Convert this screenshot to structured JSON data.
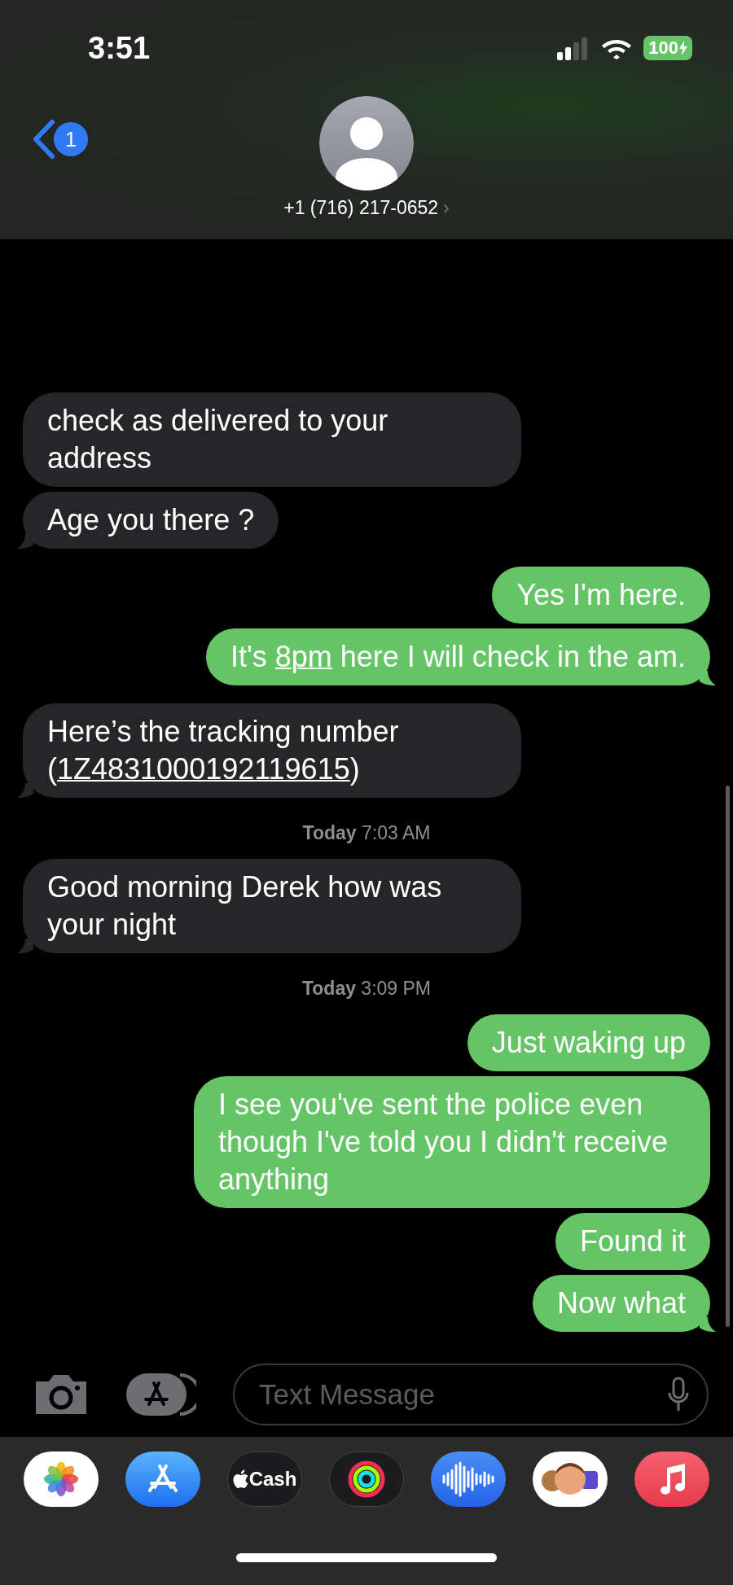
{
  "status_bar": {
    "time": "3:51",
    "battery": "100"
  },
  "header": {
    "back_badge": "1",
    "contact": "+1 (716) 217-0652",
    "chevron": "›"
  },
  "messages": [
    {
      "kind": "message",
      "outgoing": false,
      "parts": [
        {
          "text": "check as delivered to your address"
        }
      ]
    },
    {
      "kind": "message",
      "outgoing": false,
      "parts": [
        {
          "text": "Age you there ?"
        }
      ]
    },
    {
      "kind": "message",
      "outgoing": true,
      "parts": [
        {
          "text": "Yes I'm here."
        }
      ]
    },
    {
      "kind": "message",
      "outgoing": true,
      "parts": [
        {
          "text": "It's "
        },
        {
          "text": "8pm",
          "link": true
        },
        {
          "text": " here I will check in the am."
        }
      ]
    },
    {
      "kind": "message",
      "outgoing": false,
      "parts": [
        {
          "text": "Here’s the tracking number ("
        },
        {
          "text": "1Z4831000192119615",
          "link": true
        },
        {
          "text": ")"
        }
      ]
    },
    {
      "kind": "timestamp",
      "text": "**Today** 7:03 AM"
    },
    {
      "kind": "message",
      "outgoing": false,
      "parts": [
        {
          "text": "Good morning Derek how was your night"
        }
      ]
    },
    {
      "kind": "timestamp",
      "text": "**Today** 3:09 PM"
    },
    {
      "kind": "message",
      "outgoing": true,
      "parts": [
        {
          "text": "Just waking up"
        }
      ]
    },
    {
      "kind": "message",
      "outgoing": true,
      "parts": [
        {
          "text": "I see you've sent the police even though I've told you I didn't receive anything"
        }
      ]
    },
    {
      "kind": "message",
      "outgoing": true,
      "parts": [
        {
          "text": "Found it"
        }
      ]
    },
    {
      "kind": "message",
      "outgoing": true,
      "parts": [
        {
          "text": "Now what"
        }
      ]
    }
  ],
  "composer": {
    "placeholder": "Text Message"
  },
  "app_drawer": [
    {
      "kind": "photos"
    },
    {
      "kind": "appstore"
    },
    {
      "kind": "cash",
      "label": "Cash"
    },
    {
      "kind": "activity"
    },
    {
      "kind": "audio"
    },
    {
      "kind": "memoji"
    },
    {
      "kind": "music"
    }
  ]
}
